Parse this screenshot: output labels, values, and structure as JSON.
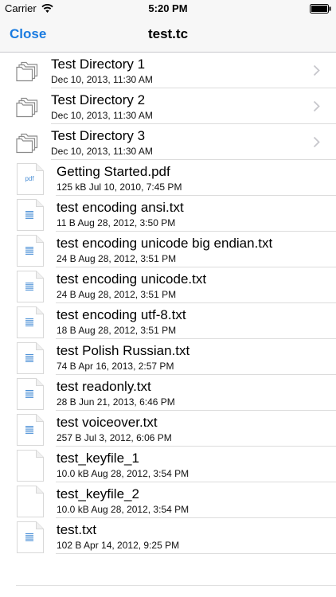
{
  "status_bar": {
    "carrier": "Carrier",
    "time": "5:20 PM",
    "icons": [
      "wifi-icon",
      "battery-icon"
    ]
  },
  "nav": {
    "close_label": "Close",
    "title": "test.tc",
    "accent_color": "#1a7be0"
  },
  "items": [
    {
      "type": "directory",
      "name": "Test Directory 1",
      "meta": "Dec 10, 2013, 11:30 AM",
      "icon": "folder-icon"
    },
    {
      "type": "directory",
      "name": "Test Directory 2",
      "meta": "Dec 10, 2013, 11:30 AM",
      "icon": "folder-icon"
    },
    {
      "type": "directory",
      "name": "Test Directory 3",
      "meta": "Dec 10, 2013, 11:30 AM",
      "icon": "folder-icon"
    },
    {
      "type": "file",
      "name": "Getting Started.pdf",
      "meta": "125 kB  Jul 10, 2010, 7:45 PM",
      "icon": "pdf-file-icon",
      "icon_label": "pdf"
    },
    {
      "type": "file",
      "name": "test encoding ansi.txt",
      "meta": "11 B  Aug 28, 2012, 3:50 PM",
      "icon": "text-file-icon"
    },
    {
      "type": "file",
      "name": "test encoding unicode big endian.txt",
      "meta": "24 B  Aug 28, 2012, 3:51 PM",
      "icon": "text-file-icon"
    },
    {
      "type": "file",
      "name": "test encoding unicode.txt",
      "meta": "24 B  Aug 28, 2012, 3:51 PM",
      "icon": "text-file-icon"
    },
    {
      "type": "file",
      "name": "test encoding utf-8.txt",
      "meta": "18 B  Aug 28, 2012, 3:51 PM",
      "icon": "text-file-icon"
    },
    {
      "type": "file",
      "name": "test Polish Russian.txt",
      "meta": "74 B  Apr 16, 2013, 2:57 PM",
      "icon": "text-file-icon"
    },
    {
      "type": "file",
      "name": "test readonly.txt",
      "meta": "28 B  Jun 21, 2013, 6:46 PM",
      "icon": "text-file-icon"
    },
    {
      "type": "file",
      "name": "test voiceover.txt",
      "meta": "257 B  Jul 3, 2012, 6:06 PM",
      "icon": "text-file-icon"
    },
    {
      "type": "file",
      "name": "test_keyfile_1",
      "meta": "10.0 kB  Aug 28, 2012, 3:54 PM",
      "icon": "blank-file-icon"
    },
    {
      "type": "file",
      "name": "test_keyfile_2",
      "meta": "10.0 kB  Aug 28, 2012, 3:54 PM",
      "icon": "blank-file-icon"
    },
    {
      "type": "file",
      "name": "test.txt",
      "meta": "102 B  Apr 14, 2012, 9:25 PM",
      "icon": "text-file-icon"
    }
  ]
}
